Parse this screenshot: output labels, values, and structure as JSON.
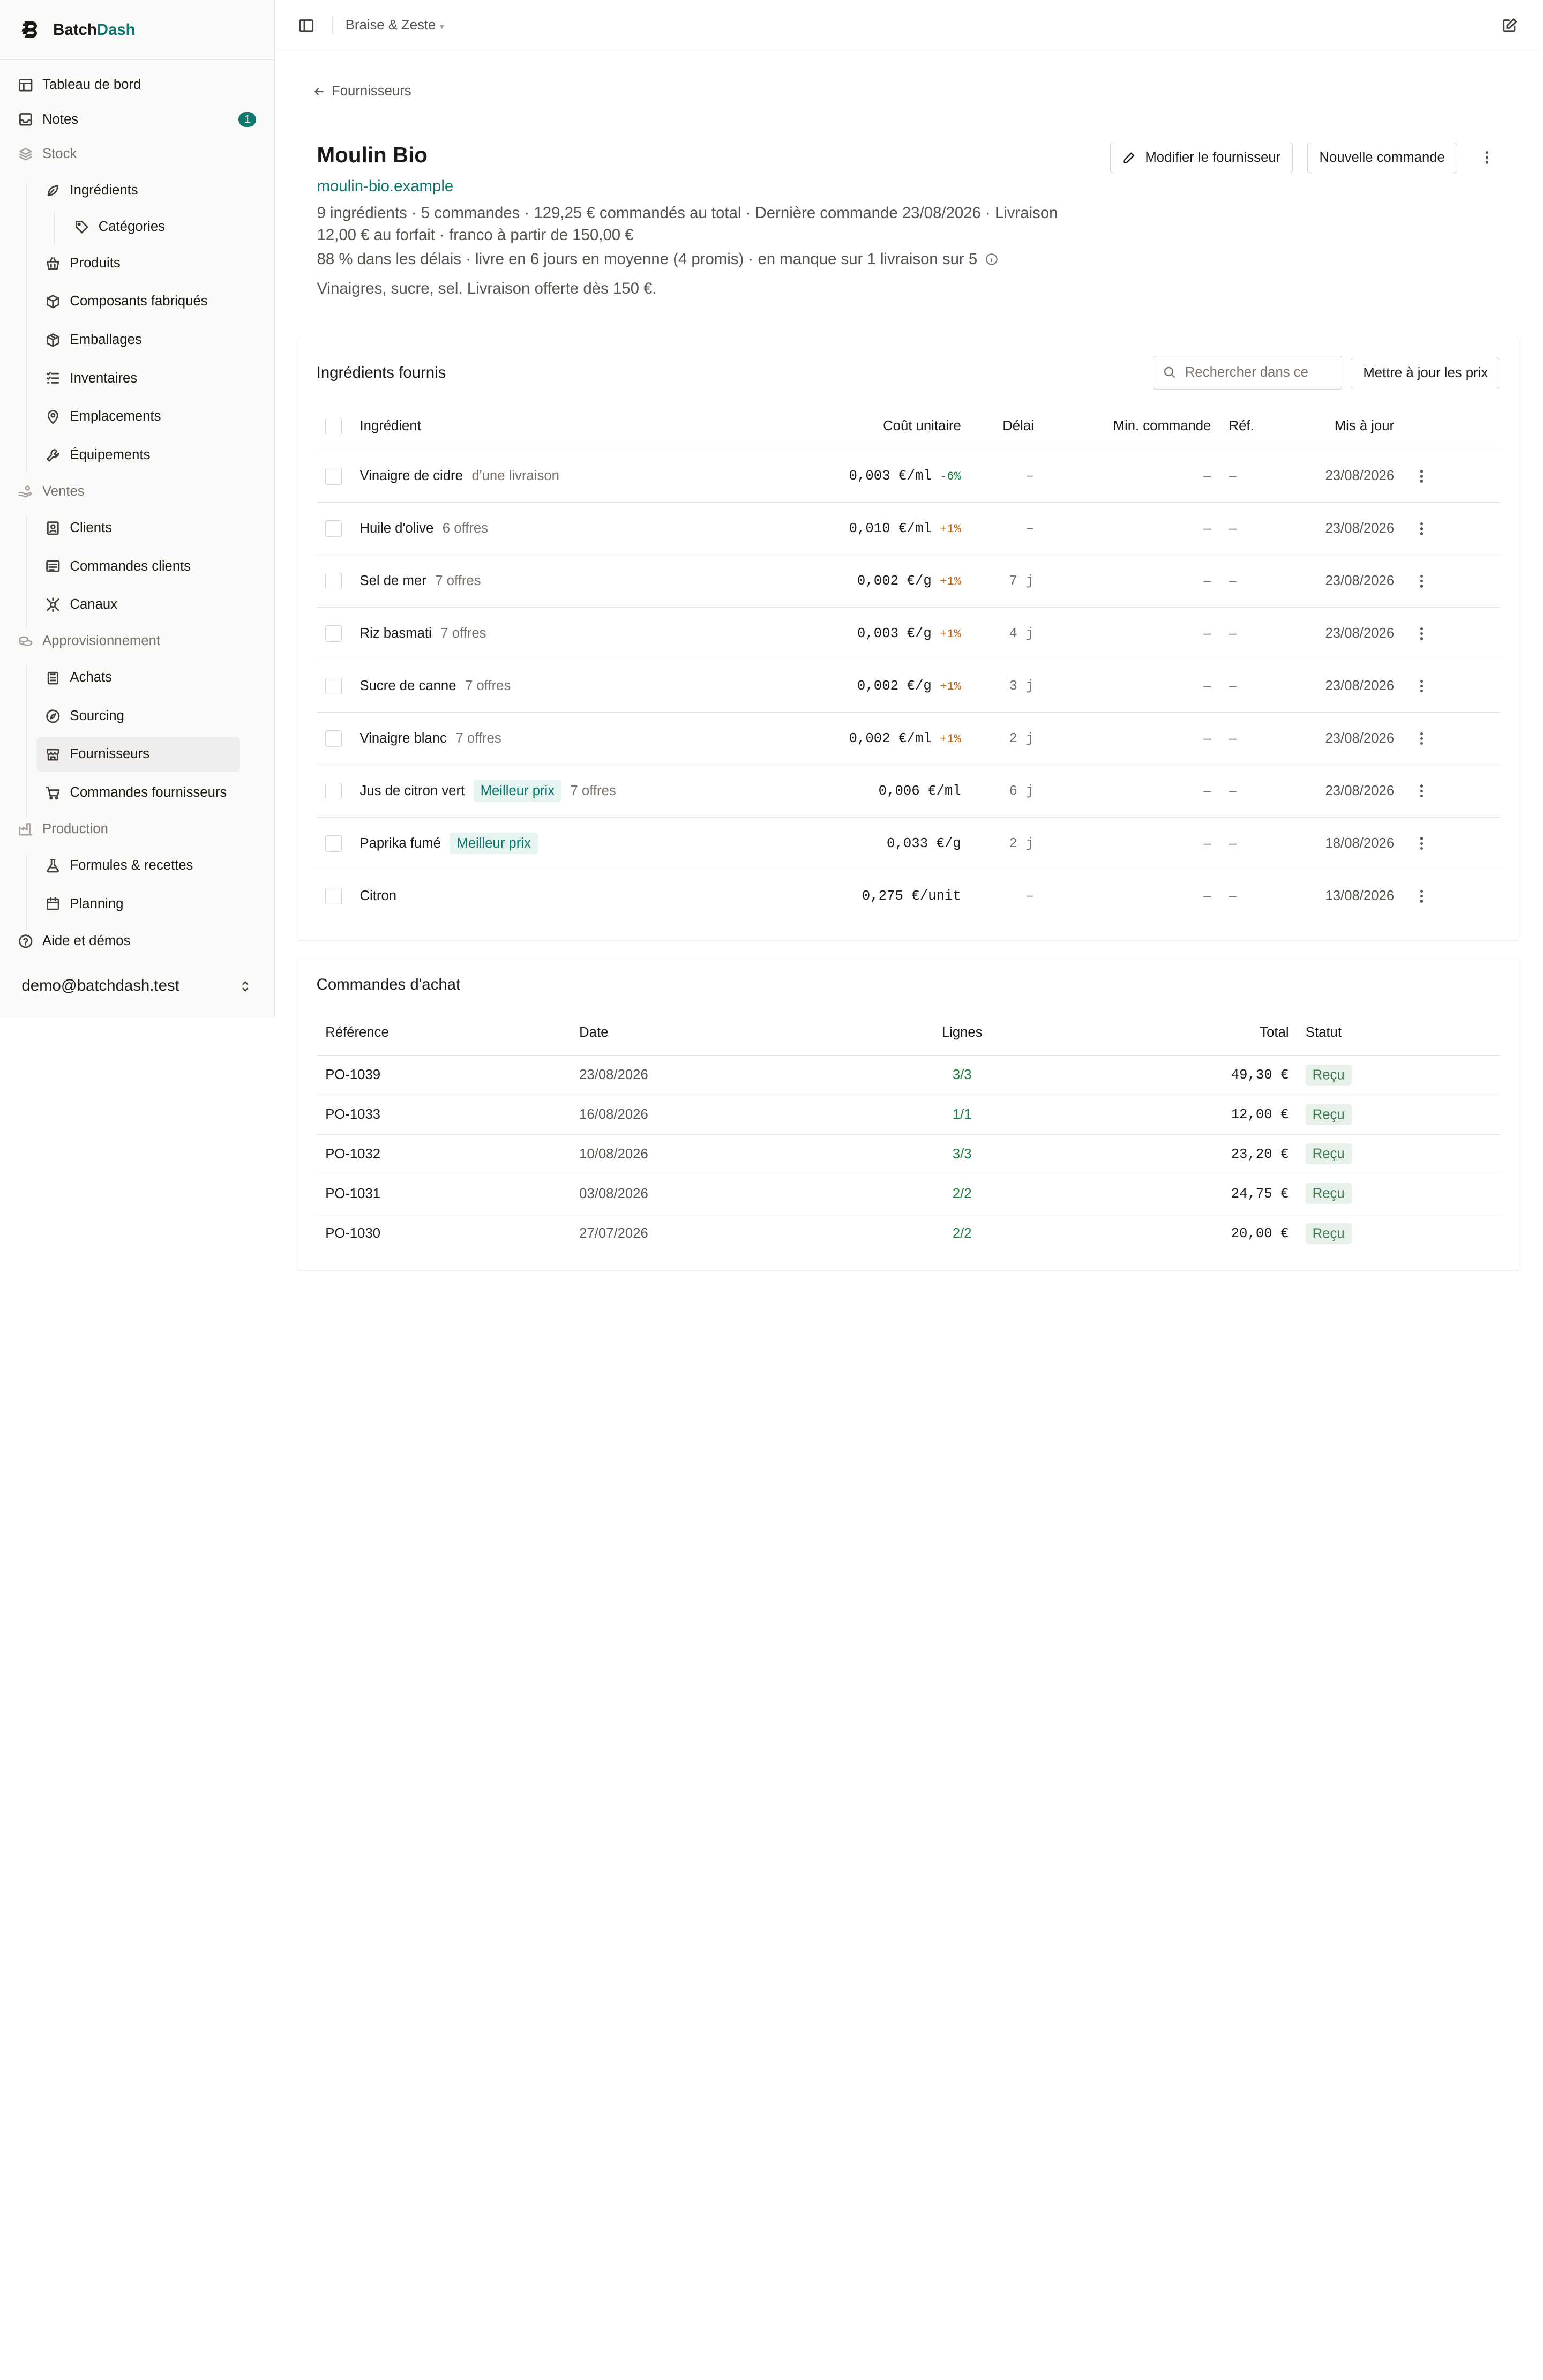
{
  "brand": {
    "name_a": "Batch",
    "name_b": "Dash",
    "accent": "#0f766e"
  },
  "sidebar": {
    "items": {
      "dashboard": "Tableau de bord",
      "notes": "Notes",
      "notes_count": "1",
      "stock": "Stock",
      "ingredients": "Ingrédients",
      "categories": "Catégories",
      "produits": "Produits",
      "composants": "Composants fabriqués",
      "emballages": "Emballages",
      "inventaires": "Inventaires",
      "emplacements": "Emplacements",
      "equipements": "Équipements",
      "ventes": "Ventes",
      "clients": "Clients",
      "commandes_clients": "Commandes clients",
      "canaux": "Canaux",
      "approvisionnement": "Approvisionnement",
      "achats": "Achats",
      "sourcing": "Sourcing",
      "fournisseurs": "Fournisseurs",
      "commandes_fournisseurs": "Commandes fournisseurs",
      "production": "Production",
      "formules": "Formules & recettes",
      "planning": "Planning",
      "aide": "Aide et démos"
    },
    "user_email": "demo@batchdash.test"
  },
  "topbar": {
    "workspace": "Braise & Zeste"
  },
  "page": {
    "back_label": "Fournisseurs",
    "supplier_name": "Moulin Bio",
    "supplier_url": "moulin-bio.example",
    "meta_line": "9 ingrédients · 5 commandes · 129,25 € commandés au total · Dernière commande 23/08/2026 · Livraison 12,00 € au forfait · franco à partir de 150,00 €",
    "reliability_line": "88 % dans les délais · livre en 6 jours en moyenne (4 promis) · en manque sur 1 livraison sur 5",
    "notes": "Vinaigres, sucre, sel. Livraison offerte dès 150 €.",
    "edit_button": "Modifier le fournisseur",
    "new_order_button": "Nouvelle commande"
  },
  "ingredients_card": {
    "title": "Ingrédients fournis",
    "search_placeholder": "Rechercher dans ce",
    "update_prices_button": "Mettre à jour les prix",
    "headers": {
      "ingredient": "Ingrédient",
      "cost": "Coût unitaire",
      "delay": "Délai",
      "min_order": "Min. commande",
      "ref": "Réf.",
      "updated": "Mis à jour"
    },
    "rows": [
      {
        "name": "Vinaigre de cidre",
        "sub": "d'une livraison",
        "pill": "",
        "cost": "0,003 €/ml",
        "change": "-6%",
        "delay": "–",
        "min": "–",
        "ref": "–",
        "date": "23/08/2026"
      },
      {
        "name": "Huile d'olive",
        "sub": "6 offres",
        "pill": "",
        "cost": "0,010 €/ml",
        "change": "+1%",
        "delay": "–",
        "min": "–",
        "ref": "–",
        "date": "23/08/2026"
      },
      {
        "name": "Sel de mer",
        "sub": "7 offres",
        "pill": "",
        "cost": "0,002 €/g",
        "change": "+1%",
        "delay": "7 j",
        "min": "–",
        "ref": "–",
        "date": "23/08/2026"
      },
      {
        "name": "Riz basmati",
        "sub": "7 offres",
        "pill": "",
        "cost": "0,003 €/g",
        "change": "+1%",
        "delay": "4 j",
        "min": "–",
        "ref": "–",
        "date": "23/08/2026"
      },
      {
        "name": "Sucre de canne",
        "sub": "7 offres",
        "pill": "",
        "cost": "0,002 €/g",
        "change": "+1%",
        "delay": "3 j",
        "min": "–",
        "ref": "–",
        "date": "23/08/2026"
      },
      {
        "name": "Vinaigre blanc",
        "sub": "7 offres",
        "pill": "",
        "cost": "0,002 €/ml",
        "change": "+1%",
        "delay": "2 j",
        "min": "–",
        "ref": "–",
        "date": "23/08/2026"
      },
      {
        "name": "Jus de citron vert",
        "sub": "7 offres",
        "pill": "Meilleur prix",
        "cost": "0,006 €/ml",
        "change": "",
        "delay": "6 j",
        "min": "–",
        "ref": "–",
        "date": "23/08/2026"
      },
      {
        "name": "Paprika fumé",
        "sub": "",
        "pill": "Meilleur prix",
        "cost": "0,033 €/g",
        "change": "",
        "delay": "2 j",
        "min": "–",
        "ref": "–",
        "date": "18/08/2026"
      },
      {
        "name": "Citron",
        "sub": "",
        "pill": "",
        "cost": "0,275 €/unit",
        "change": "",
        "delay": "–",
        "min": "–",
        "ref": "–",
        "date": "13/08/2026"
      }
    ]
  },
  "orders_card": {
    "title": "Commandes d'achat",
    "headers": {
      "ref": "Référence",
      "date": "Date",
      "lines": "Lignes",
      "total": "Total",
      "status": "Statut"
    },
    "rows": [
      {
        "ref": "PO-1039",
        "date": "23/08/2026",
        "lines": "3/3",
        "total": "49,30 €",
        "status": "Reçu"
      },
      {
        "ref": "PO-1033",
        "date": "16/08/2026",
        "lines": "1/1",
        "total": "12,00 €",
        "status": "Reçu"
      },
      {
        "ref": "PO-1032",
        "date": "10/08/2026",
        "lines": "3/3",
        "total": "23,20 €",
        "status": "Reçu"
      },
      {
        "ref": "PO-1031",
        "date": "03/08/2026",
        "lines": "2/2",
        "total": "24,75 €",
        "status": "Reçu"
      },
      {
        "ref": "PO-1030",
        "date": "27/07/2026",
        "lines": "2/2",
        "total": "20,00 €",
        "status": "Reçu"
      }
    ]
  }
}
